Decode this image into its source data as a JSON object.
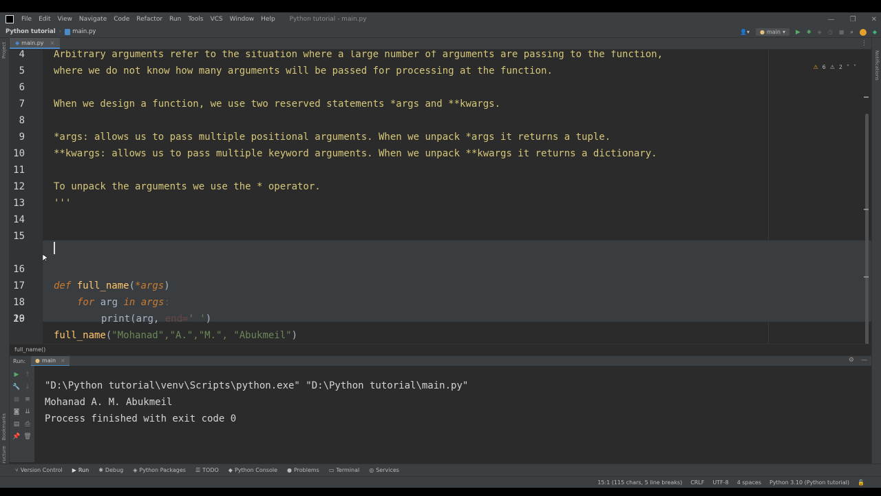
{
  "menubar": {
    "items": [
      "File",
      "Edit",
      "View",
      "Navigate",
      "Code",
      "Refactor",
      "Run",
      "Tools",
      "VCS",
      "Window",
      "Help"
    ],
    "window_title": "Python tutorial - main.py"
  },
  "navbar": {
    "project": "Python tutorial",
    "file": "main.py",
    "branch": "main"
  },
  "stripes": {
    "left_top": "Project",
    "left_bookmarks": "Bookmarks",
    "left_structure": "Structure",
    "right": "Notifications"
  },
  "editor": {
    "tab_label": "main.py",
    "inspections": {
      "warnings": "6",
      "weak_warnings": "2"
    },
    "lines": [
      {
        "n": "4",
        "text": "Arbitrary arguments refer to the situation where a large number of arguments are passing to the function,"
      },
      {
        "n": "5",
        "text": "where we do not know how many arguments will be passed for processing at the function."
      },
      {
        "n": "6",
        "text": ""
      },
      {
        "n": "7",
        "text": "When we design a function, we use two reserved statements *args and **kwargs."
      },
      {
        "n": "8",
        "text": ""
      },
      {
        "n": "9",
        "text": "*args: allows us to pass multiple positional arguments. When we unpack *args it returns a tuple."
      },
      {
        "n": "10",
        "text": "**kwargs: allows us to pass multiple keyword arguments. When we unpack **kwargs it returns a dictionary."
      },
      {
        "n": "11",
        "text": ""
      },
      {
        "n": "12",
        "text": "To unpack the arguments we use the * operator."
      },
      {
        "n": "13",
        "text": "'''"
      },
      {
        "n": "14",
        "text": ""
      },
      {
        "n": "15",
        "text": ""
      },
      {
        "n": "16",
        "text": ""
      },
      {
        "n": "17",
        "text": ""
      },
      {
        "n": "18",
        "text": ""
      },
      {
        "n": "19",
        "text": ""
      },
      {
        "n": "20",
        "text": ""
      }
    ],
    "code": {
      "l16_kw": "def",
      "l16_fn": "full_name",
      "l16_open": "(",
      "l16_param": "*args",
      "l16_close": ")",
      "l17_kw": "for",
      "l17_var": " arg ",
      "l17_in": "in",
      "l17_iter": " args",
      "l17_colon": ":",
      "l18_fn": "print",
      "l18_args": "(arg, ",
      "l18_kw": "end=",
      "l18_str": "' '",
      "l18_close": ")",
      "l19_fn": "full_name",
      "l19_open": "(",
      "l19_args": "\"Mohanad\",\"A.\",\"M.\", \"Abukmeil\"",
      "l19_close": ")"
    },
    "breadcrumb": "full_name()"
  },
  "run": {
    "label": "Run:",
    "tab": "main",
    "output": [
      "\"D:\\Python tutorial\\venv\\Scripts\\python.exe\" \"D:\\Python tutorial\\main.py\"",
      "Mohanad A. M. Abukmeil",
      "Process finished with exit code 0"
    ]
  },
  "bottom_tools": [
    "Version Control",
    "Run",
    "Debug",
    "Python Packages",
    "TODO",
    "Python Console",
    "Problems",
    "Terminal",
    "Services"
  ],
  "status": {
    "position": "15:1 (115 chars, 5 line breaks)",
    "line_sep": "CRLF",
    "encoding": "UTF-8",
    "indent": "4 spaces",
    "interpreter": "Python 3.10 (Python tutorial)"
  }
}
